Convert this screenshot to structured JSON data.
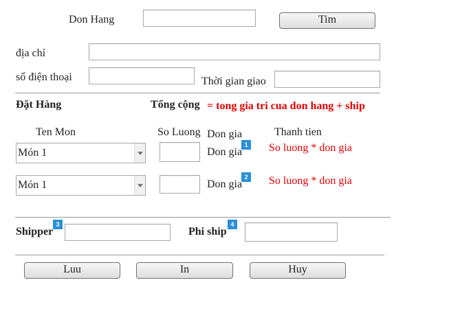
{
  "search": {
    "label": "Don Hang",
    "value": "",
    "button": "Tim"
  },
  "customer": {
    "address_label": "địa chỉ",
    "address_value": "",
    "phone_label": "số điện thoại",
    "phone_value": "",
    "delivery_label": "Thời gian giao",
    "delivery_value": ""
  },
  "order": {
    "title": "Đặt Hàng",
    "total_label": "Tổng cộng",
    "total_formula": "= tong gia tri cua don hang + ship",
    "columns": {
      "item": "Ten Mon",
      "quantity": "So Luong",
      "unit_price": "Don gia",
      "subtotal": "Thanh tien"
    },
    "rows": [
      {
        "item": "Món 1",
        "quantity": "",
        "unit_price": "Don gia",
        "subtotal": "So luong * don gia",
        "badge": "1"
      },
      {
        "item": "Món 1",
        "quantity": "",
        "unit_price": "Don gia",
        "subtotal": "So luong * don gia",
        "badge": "2"
      }
    ]
  },
  "shipping": {
    "shipper_label": "Shipper",
    "shipper_badge": "3",
    "shipper_value": "",
    "fee_label": "Phi ship",
    "fee_badge": "4",
    "fee_value": ""
  },
  "actions": {
    "save": "Luu",
    "print": "In",
    "cancel": "Huy"
  },
  "colors": {
    "formula_text": "#e00000",
    "badge": "#2a8fd6"
  }
}
